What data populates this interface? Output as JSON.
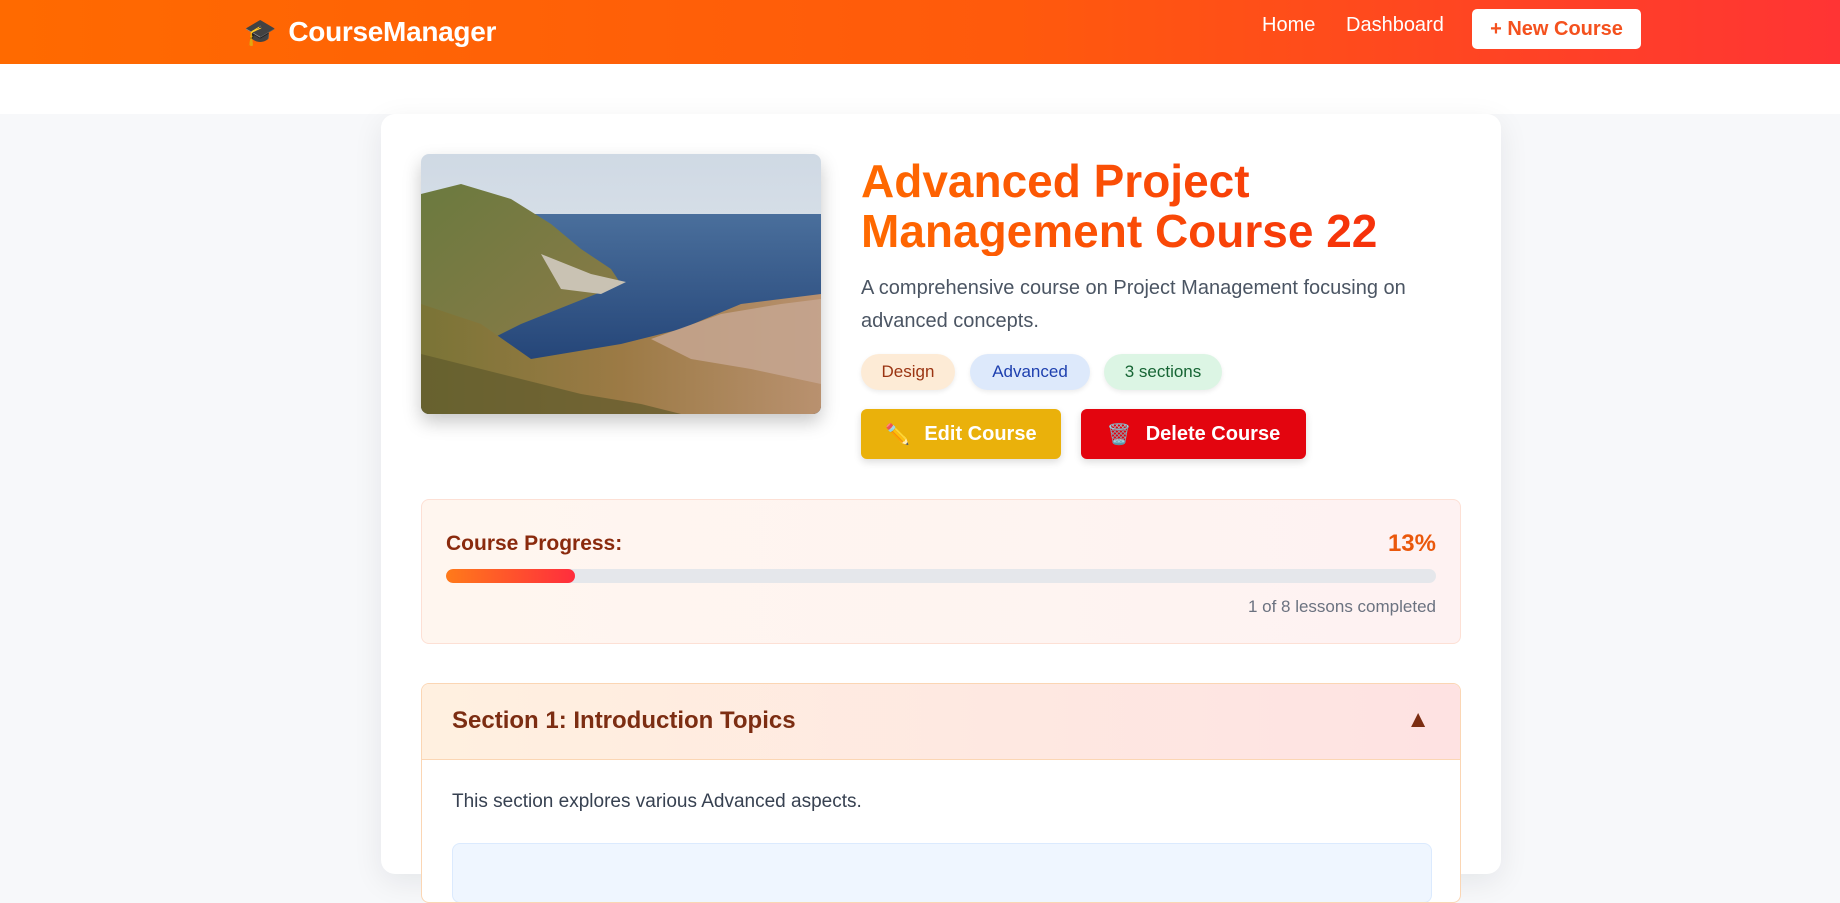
{
  "nav": {
    "brand": "CourseManager",
    "brand_icon": "🎓",
    "home": "Home",
    "dashboard": "Dashboard",
    "new_course": "+ New Course"
  },
  "course": {
    "title": "Advanced Project Management Course 22",
    "description": "A comprehensive course on Project Management focusing on advanced concepts.",
    "tags": {
      "category": "Design",
      "level": "Advanced",
      "sections": "3 sections"
    },
    "edit_label": "Edit Course",
    "edit_icon": "✏️",
    "delete_label": "Delete Course",
    "delete_icon": "🗑️"
  },
  "progress": {
    "label": "Course Progress:",
    "percent_text": "13%",
    "fraction": 0.13,
    "note": "1 of 8 lessons completed"
  },
  "sections": [
    {
      "title": "Section 1: Introduction Topics",
      "toggle": "▲",
      "description": "This section explores various Advanced aspects."
    }
  ],
  "colors": {
    "nav_start": "#ff6a00",
    "nav_end": "#ff3434",
    "edit": "#eab10b",
    "delete": "#e3050f"
  }
}
